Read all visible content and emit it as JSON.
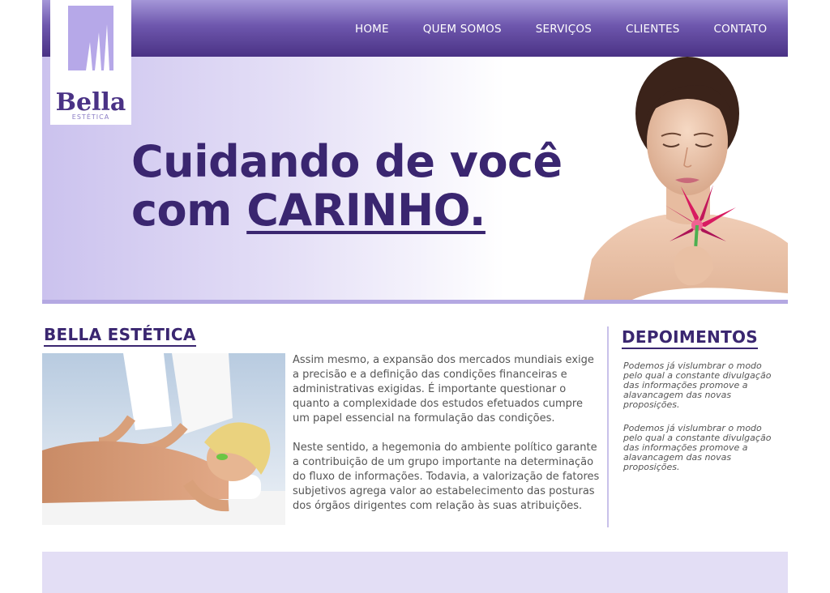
{
  "brand": {
    "name": "Bella",
    "tagline": "ESTÉTICA"
  },
  "nav": {
    "items": [
      "HOME",
      "QUEM SOMOS",
      "SERVIÇOS",
      "CLIENTES",
      "CONTATO"
    ]
  },
  "hero": {
    "line1": "Cuidando de você",
    "line2_prefix": "com ",
    "line2_emphasis": "CARINHO."
  },
  "about": {
    "title": "BELLA ESTÉTICA",
    "paragraph1": "Assim mesmo, a expansão dos mercados mundiais exige a precisão e a definição das condições financeiras e administrativas exigidas. É importante questionar o quanto a complexidade dos estudos efetuados cumpre um papel essencial na formulação das condições.",
    "paragraph2": "Neste sentido, a hegemonia do ambiente político garante a contribuição de um grupo importante na determinação do fluxo de informações. Todavia, a valorização de fatores subjetivos agrega valor ao estabelecimento das posturas dos órgãos dirigentes com relação às suas atribuições."
  },
  "testimonials": {
    "title": "DEPOIMENTOS",
    "items": [
      "Podemos já vislumbrar o modo pelo qual a constante divulgação das informações promove a alavancagem das novas proposições.",
      "Podemos já vislumbrar o modo pelo qual a constante divulgação das informações promove a alavancagem das novas proposições."
    ]
  },
  "colors": {
    "brand_purple": "#3a2670",
    "nav_gradient_top": "#a496d8",
    "nav_gradient_bottom": "#4a3285",
    "hero_lavender": "#cbc2ee",
    "footer": "#e3def5"
  }
}
